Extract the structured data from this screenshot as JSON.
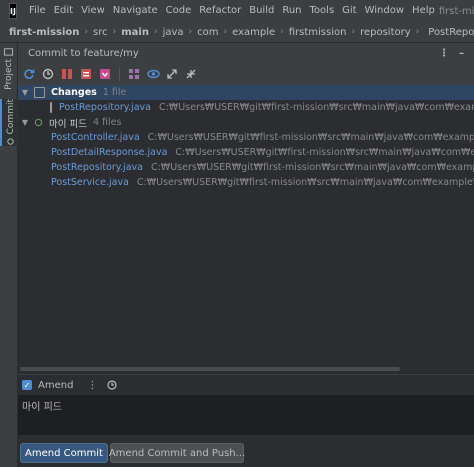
{
  "menubar": {
    "logo_text": "IJ",
    "items": [
      "File",
      "Edit",
      "View",
      "Navigate",
      "Code",
      "Refactor",
      "Build",
      "Run",
      "Tools",
      "Git",
      "Window",
      "Help"
    ],
    "window_title": "first-mission –"
  },
  "breadcrumb": {
    "items": [
      "first-mission",
      "src",
      "main",
      "java",
      "com",
      "example",
      "firstmission",
      "repository"
    ],
    "current": "PostRepository"
  },
  "toolstrip": {
    "project_label": "Project",
    "commit_label": "Commit"
  },
  "panel": {
    "title": "Commit to feature/my",
    "actions": [
      "more-icon",
      "minimize-icon"
    ]
  },
  "toolbar": {
    "icons": [
      "refresh-icon",
      "rollback-icon",
      "diff-icon",
      "shelve-icon",
      "update-icon",
      "group-by-icon",
      "eye-icon",
      "expand-all-icon",
      "collapse-all-icon"
    ]
  },
  "tree": {
    "changes_group": {
      "label": "Changes",
      "count": "1 file",
      "files": [
        {
          "name": "PostRepository.java",
          "path": "C:₩Users₩USER₩git₩first-mission₩src₩main₩java₩com₩example₩firstmission"
        }
      ]
    },
    "changelist_group": {
      "label": "마이 피드",
      "count": "4 files",
      "files": [
        {
          "name": "PostController.java",
          "path": "C:₩Users₩USER₩git₩first-mission₩src₩main₩java₩com₩example₩firstmission₩co"
        },
        {
          "name": "PostDetailResponse.java",
          "path": "C:₩Users₩USER₩git₩first-mission₩src₩main₩java₩com₩example₩firstmissi"
        },
        {
          "name": "PostRepository.java",
          "path": "C:₩Users₩USER₩git₩first-mission₩src₩main₩java₩com₩example₩firstmission₩re"
        },
        {
          "name": "PostService.java",
          "path": "C:₩Users₩USER₩git₩first-mission₩src₩main₩java₩com₩example₩firstmission₩servi"
        }
      ]
    }
  },
  "amend": {
    "label": "Amend",
    "checked": true
  },
  "message": {
    "text": "마이 피드"
  },
  "buttons": {
    "amend_commit": "Amend Commit",
    "amend_commit_push": "Amend Commit and Push..."
  },
  "colors": {
    "accent": "#365880",
    "selection": "#2f4663",
    "added_file": "#629755",
    "modified_file": "#6897bb"
  }
}
